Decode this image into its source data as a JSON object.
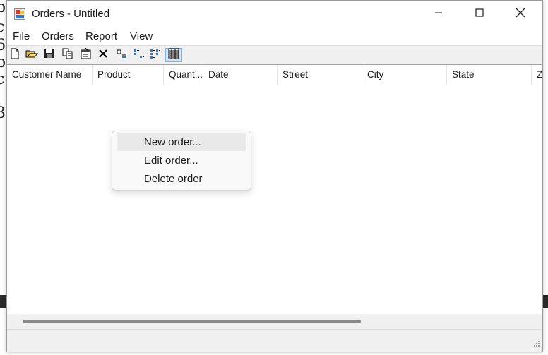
{
  "window": {
    "title": "Orders - Untitled",
    "controls": [
      "minimize-icon",
      "maximize-icon",
      "close-icon"
    ]
  },
  "menubar": {
    "items": [
      {
        "label": "File"
      },
      {
        "label": "Orders"
      },
      {
        "label": "Report"
      },
      {
        "label": "View"
      }
    ]
  },
  "toolbar": {
    "buttons": [
      {
        "icon": "new-document-icon"
      },
      {
        "icon": "open-folder-icon"
      },
      {
        "icon": "save-icon"
      },
      {
        "icon": "copy-icon"
      },
      {
        "icon": "properties-icon"
      },
      {
        "icon": "delete-icon"
      },
      {
        "icon": "large-icons-view-icon"
      },
      {
        "icon": "small-icons-view-icon"
      },
      {
        "icon": "list-view-icon"
      },
      {
        "icon": "details-view-icon",
        "active": true
      }
    ]
  },
  "listview": {
    "columns": [
      {
        "label": "Customer Name"
      },
      {
        "label": "Product"
      },
      {
        "label": "Quant..."
      },
      {
        "label": "Date"
      },
      {
        "label": "Street"
      },
      {
        "label": "City"
      },
      {
        "label": "State"
      },
      {
        "label": "Z"
      }
    ],
    "rows": []
  },
  "context_menu": {
    "items": [
      {
        "label": "New order...",
        "highlighted": true
      },
      {
        "label": "Edit order..."
      },
      {
        "label": "Delete order"
      }
    ]
  },
  "colors": {
    "window_bg": "#f0f0f0",
    "titlebar_bg": "#ffffff",
    "active_toolbar_button": "#cfe4f7",
    "menu_highlight": "#e9e9e9"
  }
}
